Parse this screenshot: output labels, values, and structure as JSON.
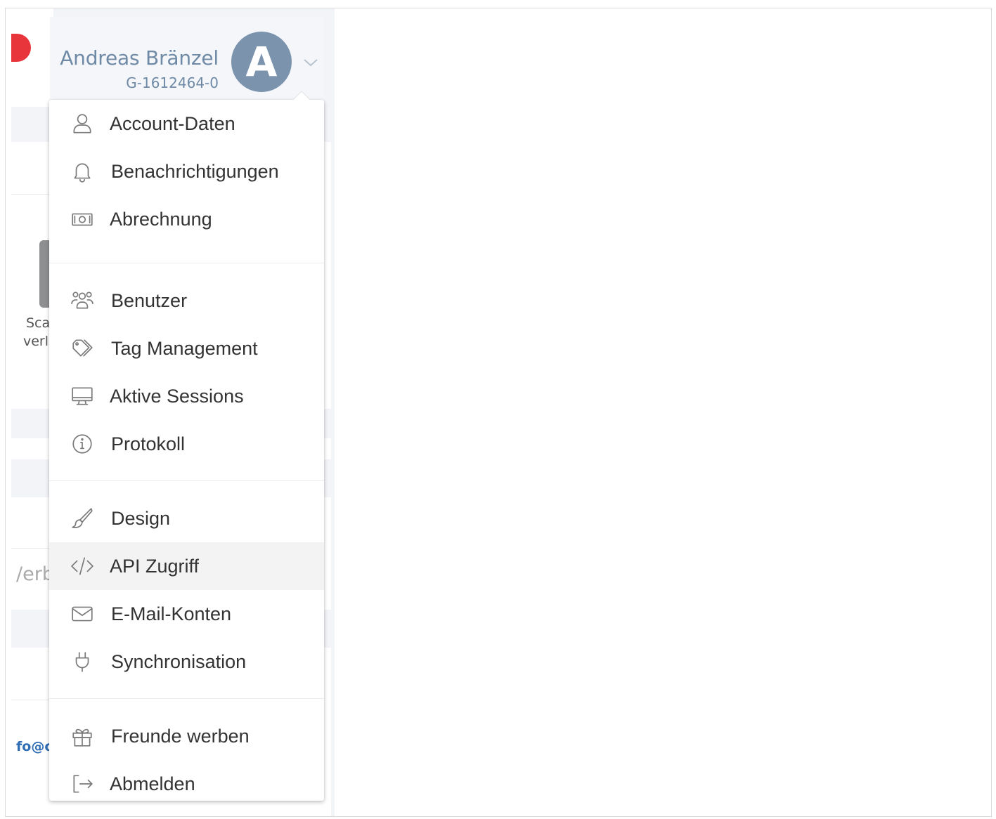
{
  "user": {
    "name": "Andreas Bränzel",
    "id": "G-1612464-0",
    "avatar_letter": "A",
    "avatar_color": "#7b93ad"
  },
  "background_fragments": {
    "text_1": "Sca",
    "text_2": "verl",
    "text_3": "/erb",
    "text_4": "fo@c"
  },
  "menu": {
    "groups": [
      [
        {
          "label": "Account-Daten",
          "icon": "user-icon"
        },
        {
          "label": "Benachrichtigungen",
          "icon": "bell-icon"
        },
        {
          "label": "Abrechnung",
          "icon": "banknote-icon"
        }
      ],
      [
        {
          "label": "Benutzer",
          "icon": "users-icon"
        },
        {
          "label": "Tag Management",
          "icon": "tag-icon"
        },
        {
          "label": "Aktive Sessions",
          "icon": "monitor-icon"
        },
        {
          "label": "Protokoll",
          "icon": "info-icon"
        }
      ],
      [
        {
          "label": "Design",
          "icon": "brush-icon"
        },
        {
          "label": "API Zugriff",
          "icon": "code-icon",
          "active": true
        },
        {
          "label": "E-Mail-Konten",
          "icon": "envelope-icon"
        },
        {
          "label": "Synchronisation",
          "icon": "plug-icon"
        }
      ],
      [
        {
          "label": "Freunde werben",
          "icon": "gift-icon"
        },
        {
          "label": "Abmelden",
          "icon": "logout-icon"
        }
      ]
    ]
  },
  "colors": {
    "accent": "#6f8aa6",
    "active_item_bg": "#f3f3f3",
    "icon": "#7a7a7a"
  }
}
